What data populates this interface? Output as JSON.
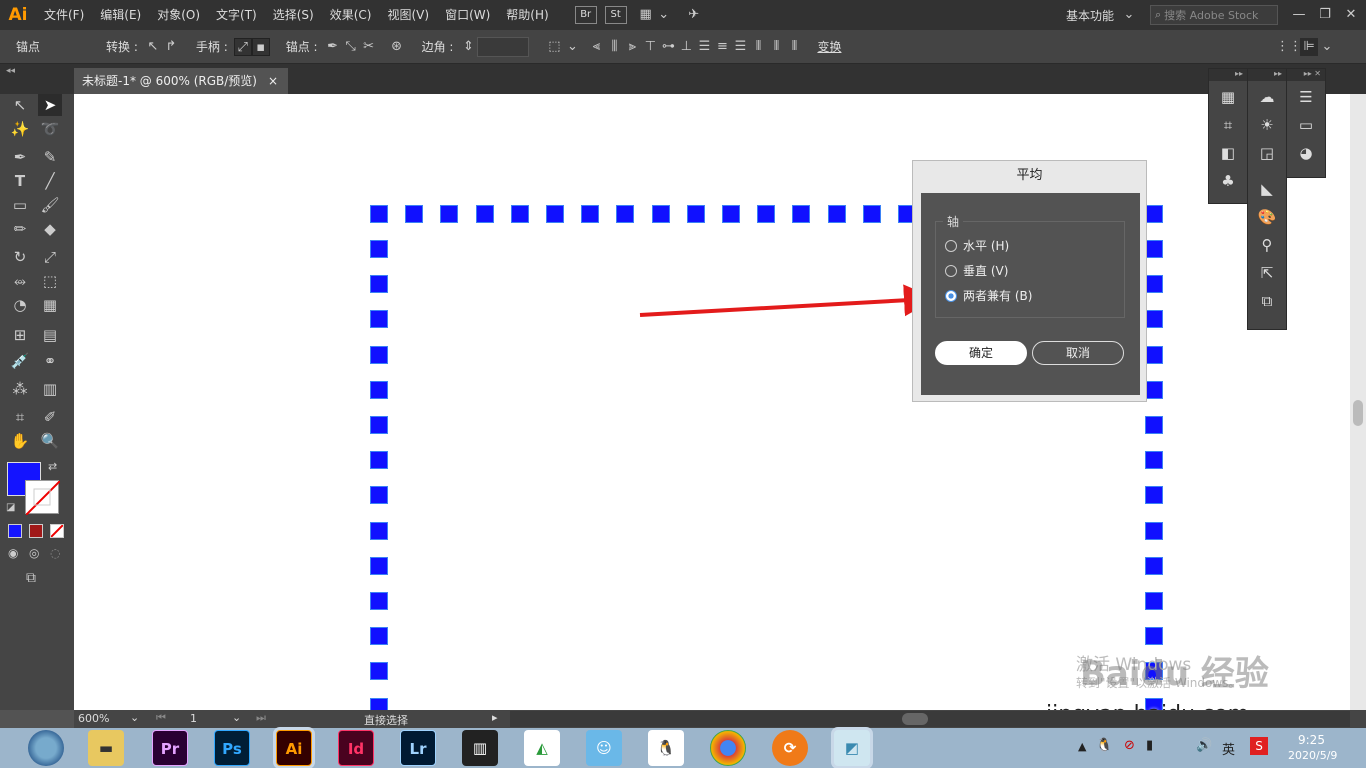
{
  "app": {
    "logo": "Ai",
    "workspace": "基本功能",
    "search_placeholder": "搜索 Adobe Stock"
  },
  "menu": [
    "文件(F)",
    "编辑(E)",
    "对象(O)",
    "文字(T)",
    "选择(S)",
    "效果(C)",
    "视图(V)",
    "窗口(W)",
    "帮助(H)"
  ],
  "menu_buttons": [
    "Br",
    "St"
  ],
  "control": {
    "anchor": "锚点",
    "convert": "转换 :",
    "handles": "手柄 :",
    "anchors": "锚点 :",
    "corner": "边角 :",
    "transform": "变换"
  },
  "document": {
    "tab": "未标题-1* @ 600% (RGB/预览)",
    "close": "×"
  },
  "status": {
    "zoom": "600%",
    "page": "1",
    "tool": "直接选择"
  },
  "dialog": {
    "title": "平均",
    "group": "轴",
    "options": [
      {
        "label": "水平 (H)",
        "selected": false
      },
      {
        "label": "垂直 (V)",
        "selected": false
      },
      {
        "label": "两者兼有 (B)",
        "selected": true
      }
    ],
    "ok": "确定",
    "cancel": "取消"
  },
  "watermark": {
    "line1": "激活 Windows",
    "line2": "转到\"设置\"以激活 Windows。",
    "brand": "Baidu 经验",
    "url": "jingyan.baidu.com"
  },
  "taskbar": {
    "apps": [
      "Pr",
      "Ps",
      "Ai",
      "Id",
      "Lr"
    ],
    "tray_lang": "英",
    "time": "9:25",
    "date": "2020/5/9"
  },
  "colors": {
    "fill": "#1414ff",
    "shape": "#1010ff",
    "arrow": "#e31b1b"
  }
}
